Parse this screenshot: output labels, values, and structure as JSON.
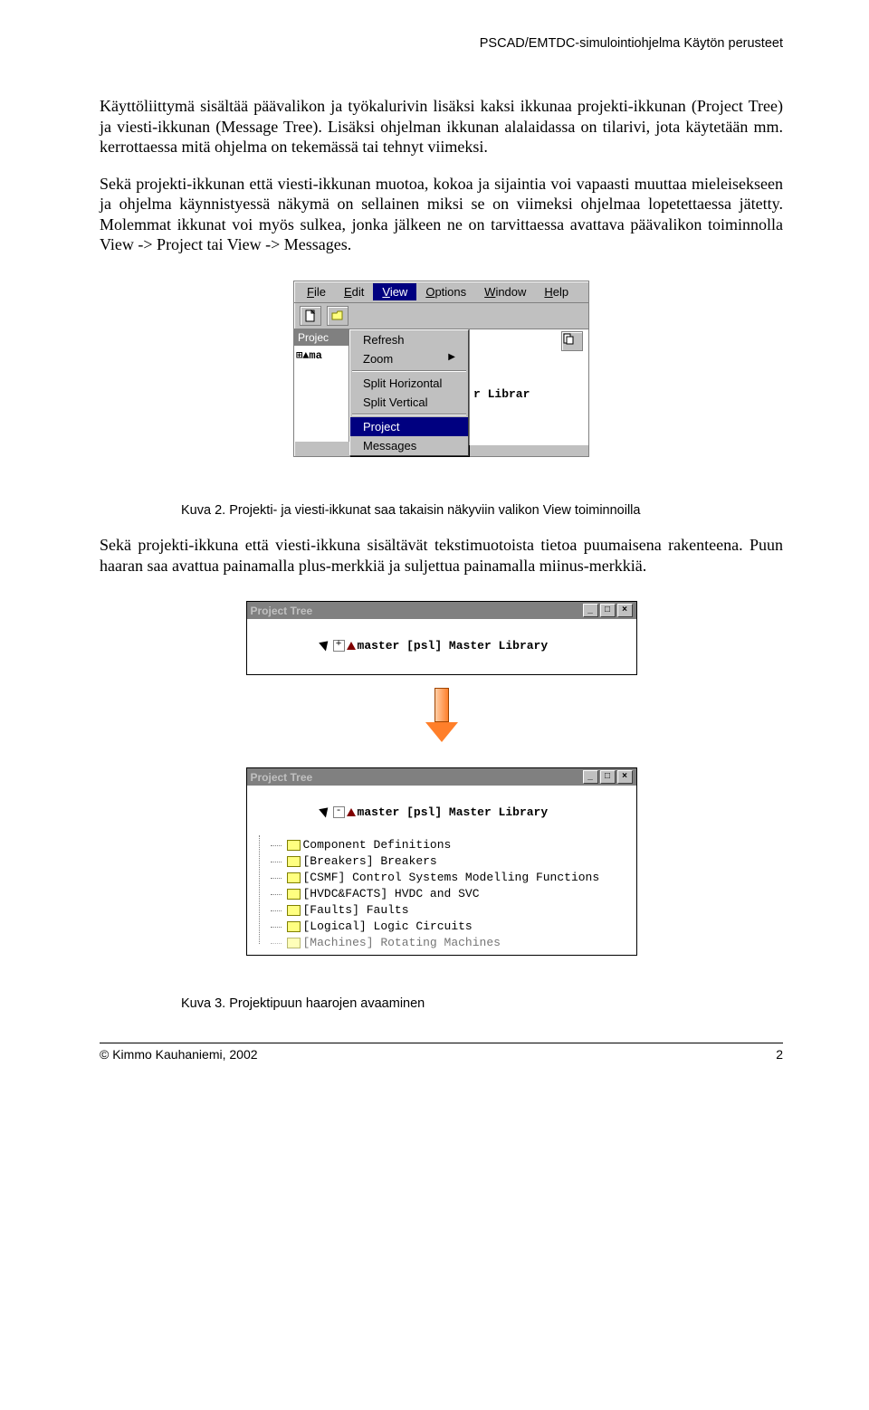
{
  "header": {
    "right": "PSCAD/EMTDC-simulointiohjelma Käytön perusteet"
  },
  "paragraphs": {
    "p1": "Käyttöliittymä sisältää päävalikon ja työkalurivin lisäksi kaksi ikkunaa projekti-ikkunan (Project Tree) ja viesti-ikkunan (Message Tree). Lisäksi ohjelman ikkunan alalaidassa on tilarivi, jota käytetään mm. kerrottaessa mitä ohjelma on tekemässä tai tehnyt viimeksi.",
    "p2": "Sekä projekti-ikkunan että viesti-ikkunan muotoa, kokoa ja sijaintia voi vapaasti muuttaa mieleisekseen ja ohjelma käynnistyessä näkymä on sellainen miksi se on viimeksi ohjelmaa lopetettaessa jätetty. Molemmat ikkunat voi myös sulkea, jonka jälkeen ne on tarvittaessa avattava päävalikon toiminnolla View -> Project tai View -> Messages.",
    "cap2": "Kuva 2. Projekti- ja viesti-ikkunat saa takaisin näkyviin valikon View toiminnoilla",
    "p3": "Sekä projekti-ikkuna että viesti-ikkuna sisältävät tekstimuotoista tietoa puumaisena rakenteena. Puun haaran saa avattua painamalla plus-merkkiä ja suljettua painamalla miinus-merkkiä.",
    "cap3": "Kuva 3. Projektipuun haarojen avaaminen"
  },
  "menu": {
    "file": "File",
    "edit": "Edit",
    "view": "View",
    "options": "Options",
    "window": "Window",
    "help": "Help",
    "refresh": "Refresh",
    "zoom": "Zoom",
    "splitH": "Split Horizontal",
    "splitV": "Split Vertical",
    "project": "Project",
    "messages": "Messages",
    "projStrip": "Projec",
    "projNode": "⊞▲ma",
    "rightText": "r Librar"
  },
  "tree": {
    "title": "Project Tree",
    "root": "master [psl] Master Library",
    "children": [
      "Component Definitions",
      "[Breakers] Breakers",
      "[CSMF] Control Systems Modelling Functions",
      "[HVDC&FACTS] HVDC and SVC",
      "[Faults] Faults",
      "[Logical] Logic Circuits",
      "[Machines] Rotating Machines"
    ]
  },
  "footer": {
    "left": "© Kimmo Kauhaniemi, 2002",
    "right": "2"
  }
}
